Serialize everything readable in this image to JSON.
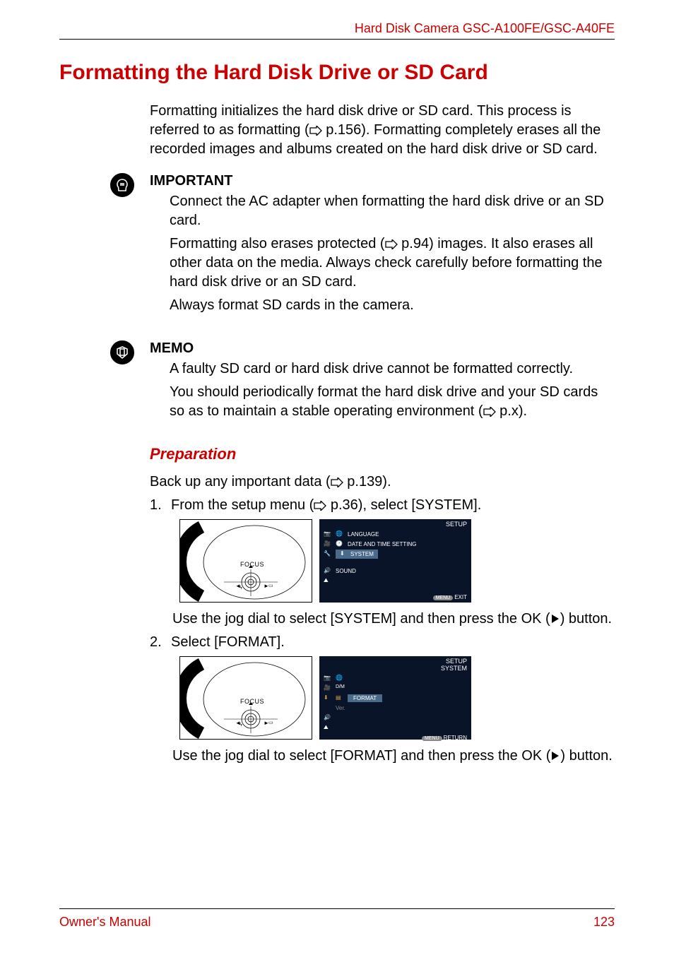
{
  "header": {
    "product_line": "Hard Disk Camera GSC-A100FE/GSC-A40FE"
  },
  "title": "Formatting the Hard Disk Drive or SD Card",
  "intro": {
    "line1_prefix": "Formatting initializes the hard disk drive or SD card. This process is referred to as formatting (",
    "line1_pageref": " p.156). Formatting completely erases all the recorded images and albums created on the hard disk drive or SD card."
  },
  "important": {
    "heading": "IMPORTANT",
    "p1": "Connect the AC adapter when formatting the hard disk drive or an SD card.",
    "p2_prefix": "Formatting also erases protected (",
    "p2_suffix": " p.94) images. It also erases all other data on the media. Always check carefully before formatting the hard disk drive or an SD card.",
    "p3": "Always format SD cards in the camera."
  },
  "memo": {
    "heading": "MEMO",
    "p1": "A faulty SD card or hard disk drive cannot be formatted correctly.",
    "p2_prefix": "You should periodically format the hard disk drive and your SD cards so as to maintain a stable operating environment (",
    "p2_suffix": " p.x)."
  },
  "preparation": {
    "heading": "Preparation",
    "backup_prefix": "Back up any important data (",
    "backup_suffix": " p.139)."
  },
  "steps": {
    "s1_num": "1.",
    "s1_text_prefix": "From the setup menu (",
    "s1_text_suffix": " p.36), select [SYSTEM].",
    "s1_after_prefix": "Use the jog dial to select [SYSTEM] and then press the OK (",
    "s1_after_suffix": ") button.",
    "s2_num": "2.",
    "s2_text": "Select [FORMAT].",
    "s2_after_prefix": "Use the jog dial to select [FORMAT] and then press the OK (",
    "s2_after_suffix": ") button."
  },
  "screen1": {
    "title": "SETUP",
    "items": {
      "language": "LANGUAGE",
      "datetime": "DATE AND TIME SETTING",
      "system": "SYSTEM",
      "sound": "SOUND"
    },
    "footer_btn": "MENU",
    "footer_label": "EXIT"
  },
  "screen2": {
    "title1": "SETUP",
    "title2": "SYSTEM",
    "items": {
      "format": "FORMAT",
      "ver": "Ver."
    },
    "footer_btn": "MENU",
    "footer_label": "RETURN"
  },
  "dial_label": "FOCUS",
  "footer": {
    "manual": "Owner's Manual",
    "page": "123"
  }
}
